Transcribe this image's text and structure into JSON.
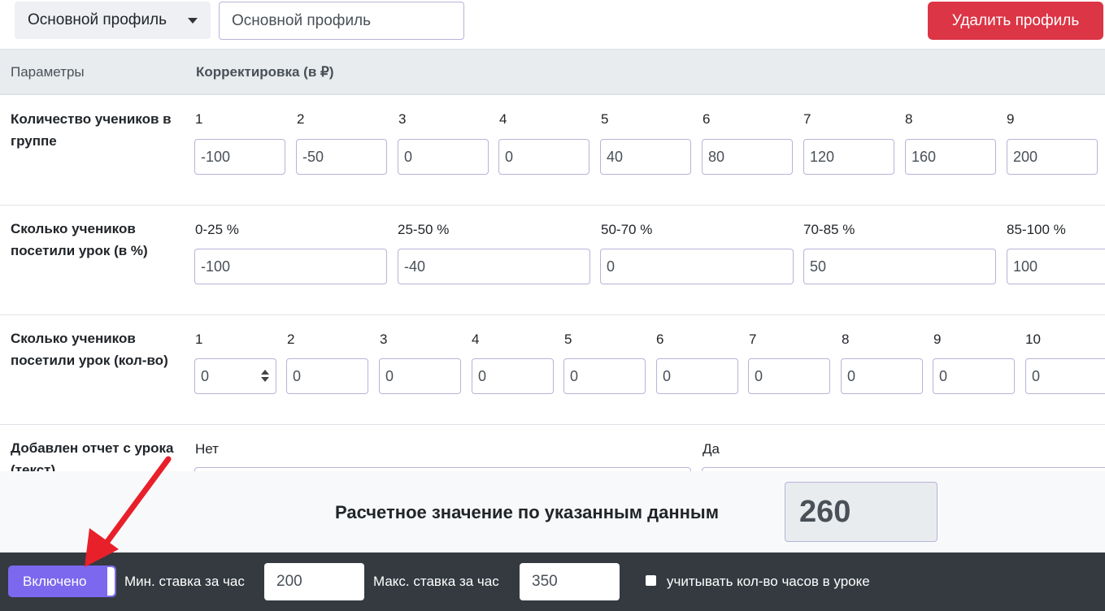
{
  "header": {
    "profile_dropdown": "Основной профиль",
    "profile_name_value": "Основной профиль",
    "delete_button": "Удалить профиль"
  },
  "table": {
    "col_params": "Параметры",
    "col_correction": "Корректировка (в ₽)",
    "rows": [
      {
        "label": "Количество учеников в группе",
        "cells": [
          {
            "label": "1",
            "value": "-100"
          },
          {
            "label": "2",
            "value": "-50"
          },
          {
            "label": "3",
            "value": "0"
          },
          {
            "label": "4",
            "value": "0"
          },
          {
            "label": "5",
            "value": "40"
          },
          {
            "label": "6",
            "value": "80"
          },
          {
            "label": "7",
            "value": "120"
          },
          {
            "label": "8",
            "value": "160"
          },
          {
            "label": "9",
            "value": "200"
          }
        ]
      },
      {
        "label": "Сколько учеников посетили урок (в %)",
        "cells": [
          {
            "label": "0-25 %",
            "value": "-100"
          },
          {
            "label": "25-50 %",
            "value": "-40"
          },
          {
            "label": "50-70 %",
            "value": "0"
          },
          {
            "label": "70-85 %",
            "value": "50"
          },
          {
            "label": "85-100 %",
            "value": "100"
          }
        ]
      },
      {
        "label": "Сколько учеников посетили урок (кол-во)",
        "cells": [
          {
            "label": "1",
            "value": "0"
          },
          {
            "label": "2",
            "value": "0"
          },
          {
            "label": "3",
            "value": "0"
          },
          {
            "label": "4",
            "value": "0"
          },
          {
            "label": "5",
            "value": "0"
          },
          {
            "label": "6",
            "value": "0"
          },
          {
            "label": "7",
            "value": "0"
          },
          {
            "label": "8",
            "value": "0"
          },
          {
            "label": "9",
            "value": "0"
          },
          {
            "label": "10",
            "value": "0"
          }
        ]
      },
      {
        "label": "Добавлен отчет с урока (текст)",
        "cells": [
          {
            "label": "Нет",
            "value": ""
          },
          {
            "label": "Да",
            "value": ""
          }
        ]
      }
    ]
  },
  "result": {
    "label": "Расчетное значение по указанным данным",
    "value": "260"
  },
  "footer": {
    "toggle_label": "Включено",
    "min_rate_label": "Мин. ставка за час",
    "min_rate_value": "200",
    "max_rate_label": "Макс. ставка за час",
    "max_rate_value": "350",
    "hours_checkbox_label": "учитывать кол-во часов в уроке"
  },
  "colors": {
    "delete": "#dc3545",
    "toggle": "#7b68ee",
    "footer_bg": "#343a40",
    "arrow": "#e8202a"
  }
}
